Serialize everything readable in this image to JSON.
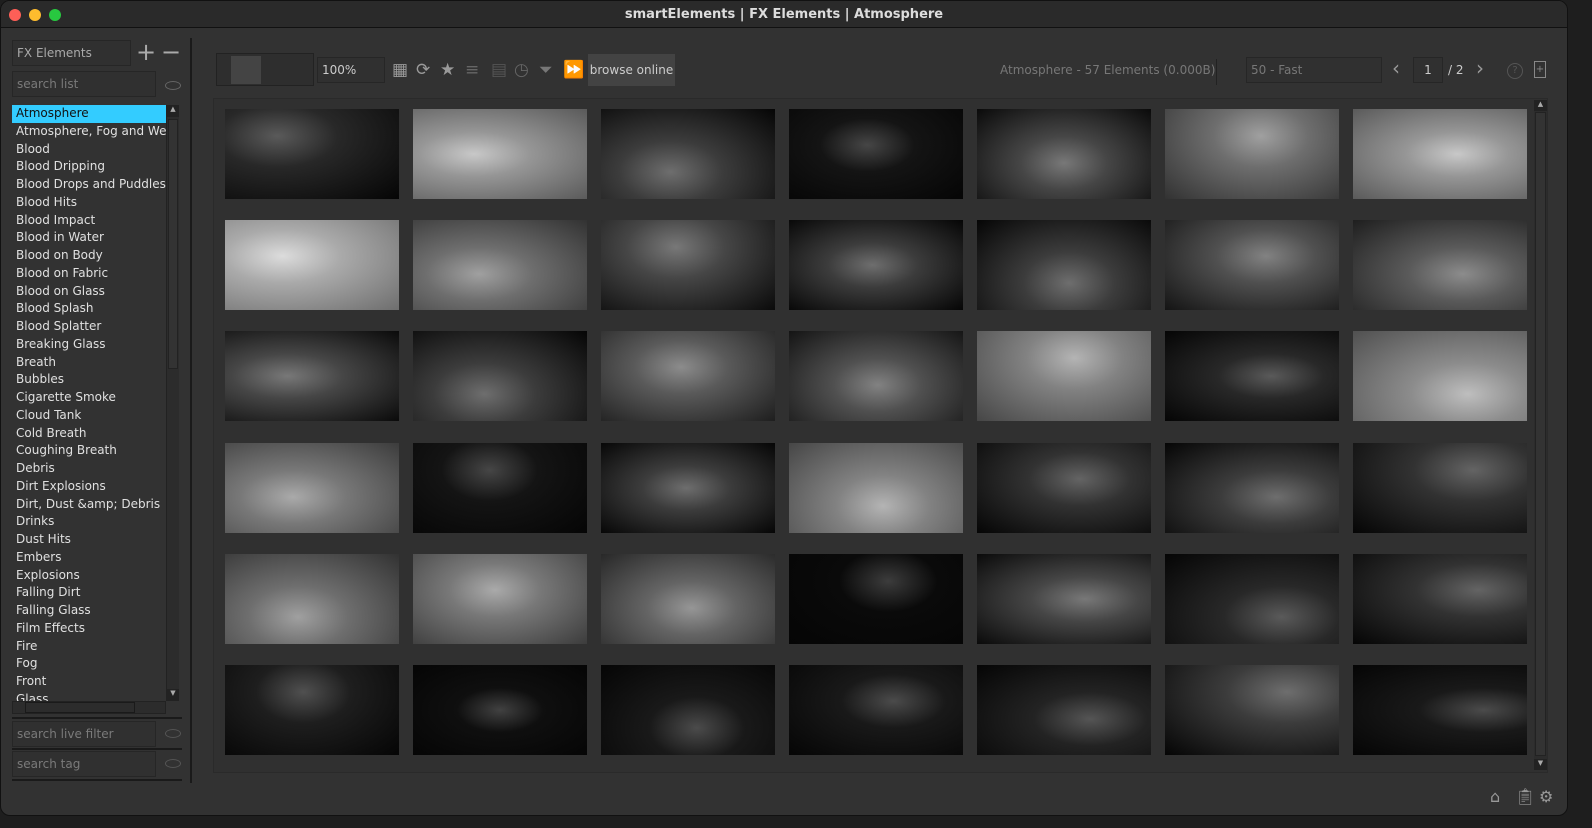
{
  "window": {
    "title": "smartElements | FX Elements | Atmosphere"
  },
  "sidebar": {
    "library": "FX Elements",
    "add_label": "+",
    "remove_label": "−",
    "search_list_placeholder": "search list",
    "search_live_filter_placeholder": "search live filter",
    "search_tag_placeholder": "search tag",
    "selected": "Atmosphere",
    "items": [
      "Atmosphere",
      "Atmosphere, Fog and Weather",
      "Blood",
      "Blood Dripping",
      "Blood Drops and Puddles",
      "Blood Hits",
      "Blood Impact",
      "Blood in Water",
      "Blood on Body",
      "Blood on Fabric",
      "Blood on Glass",
      "Blood Splash",
      "Blood Splatter",
      "Breaking Glass",
      "Breath",
      "Bubbles",
      "Cigarette Smoke",
      "Cloud Tank",
      "Cold Breath",
      "Coughing Breath",
      "Debris",
      "Dirt Explosions",
      "Dirt, Dust &amp; Debris",
      "Drinks",
      "Dust Hits",
      "Embers",
      "Explosions",
      "Falling Dirt",
      "Falling Glass",
      "Film Effects",
      "Fire",
      "Fog",
      "Front",
      "Glass"
    ]
  },
  "toolbar": {
    "zoom": "100%",
    "browse_online": "browse online",
    "status": "Atmosphere - 57 Elements (0.000B)",
    "load_mode": "50 - Fast",
    "page": "1",
    "page_total": "/ 2"
  },
  "grid": {
    "columns": 7,
    "rows": 6,
    "thumbnail_count": 42
  }
}
